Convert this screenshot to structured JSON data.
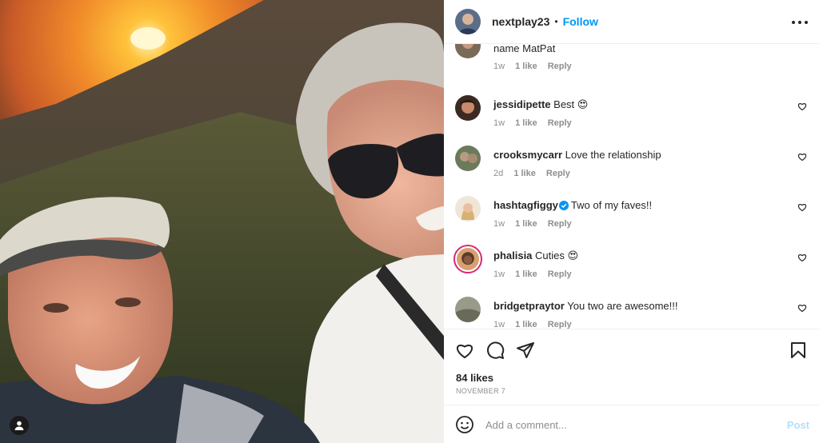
{
  "post": {
    "author": "nextplay23",
    "follow_label": "Follow",
    "separator": "•",
    "likes": "84 likes",
    "date": "NOVEMBER 7"
  },
  "comments": [
    {
      "user": "",
      "text": "name MatPat",
      "time": "1w",
      "likes": "1 like",
      "reply": "Reply",
      "avatar_color": "#7a6a58"
    },
    {
      "user": "jessidipette",
      "text": "Best 😍",
      "time": "1w",
      "likes": "1 like",
      "reply": "Reply",
      "avatar_color": "#8b5a3c"
    },
    {
      "user": "crooksmycarr",
      "text": "Love the relationship",
      "time": "2d",
      "likes": "1 like",
      "reply": "Reply",
      "avatar_color": "#6b7a5a"
    },
    {
      "user": "hashtagfiggy",
      "text": "Two of my faves!!",
      "time": "1w",
      "likes": "1 like",
      "reply": "Reply",
      "avatar_color": "#c8a878",
      "verified": true
    },
    {
      "user": "phalisia",
      "text": "Cuties 😍",
      "time": "1w",
      "likes": "1 like",
      "reply": "Reply",
      "avatar_color": "#5a3a2a"
    },
    {
      "user": "bridgetpraytor",
      "text": "You two are awesome!!!",
      "time": "1w",
      "likes": "1 like",
      "reply": "Reply",
      "avatar_color": "#8a8a7a"
    }
  ],
  "composer": {
    "placeholder": "Add a comment...",
    "post_label": "Post"
  },
  "icons": {
    "like": "heart-icon",
    "comment": "comment-bubble-icon",
    "share": "paper-plane-icon",
    "save": "bookmark-icon",
    "emoji": "smiley-icon",
    "more": "more-horizontal-icon",
    "tagged": "user-tag-icon"
  },
  "colors": {
    "accent": "#0095f6",
    "post_disabled": "#b2dffc",
    "muted": "#8e8e8e",
    "verified": "#0095f6"
  }
}
